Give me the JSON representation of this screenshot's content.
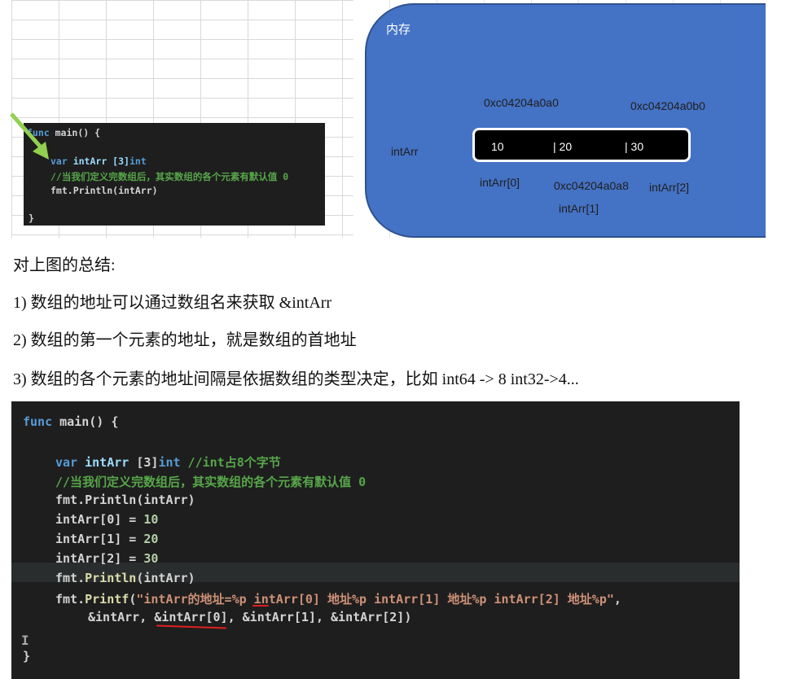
{
  "diagram": {
    "memory_title": "内存",
    "addr_first": "0xc04204a0a0",
    "addr_third": "0xc04204a0b0",
    "addr_second": "0xc04204a0a8",
    "var_label": "intArr",
    "cells": [
      "10",
      "| 20",
      "| 30"
    ],
    "idx0": "intArr[0]",
    "idx1": "intArr[1]",
    "idx2": "intArr[2]"
  },
  "small_code": {
    "l1_kw": "func",
    "l1_rest": " main() {",
    "l2_kw": "var",
    "l2_rest": " intArr [3]",
    "l2_type": "int",
    "l3": "//当我们定义完数组后，其实数组的各个元素有默认值 0",
    "l4": "fmt.Println(intArr)",
    "l5": "}"
  },
  "notes": {
    "title": "对上图的总结:",
    "item1": "1)  数组的地址可以通过数组名来获取  &intArr",
    "item2": "2)  数组的第一个元素的地址，就是数组的首地址",
    "item3": "3)  数组的各个元素的地址间隔是依据数组的类型决定，比如 int64 -> 8    int32->4..."
  },
  "code": {
    "l1_kw": "func",
    "l1_rest": " main() {",
    "l2_kw": "var",
    "l2_var": " intArr ",
    "l2_br": "[3]",
    "l2_type": "int",
    "l2_cmt": " //int占8个字节",
    "l3": "//当我们定义完数组后，其实数组的各个元素有默认值 0",
    "l4": "fmt.Println(intArr)",
    "l5_a": "intArr[0] = ",
    "l5_n": "10",
    "l6_a": "intArr[1] = ",
    "l6_n": "20",
    "l7_a": "intArr[2] = ",
    "l7_n": "30",
    "l8_a": "fmt.",
    "l8_f": "Println",
    "l8_b": "(intArr)",
    "l9_a": "fmt.",
    "l9_f": "Printf",
    "l9_b": "(",
    "l9_s": "\"intArr的地址=%p intArr[0] 地址%p intArr[1] 地址%p intArr[2] 地址%p\"",
    "l9_e": ",",
    "l10": "&intArr, &intArr[0], &intArr[1], &intArr[2])",
    "l11": "}"
  }
}
